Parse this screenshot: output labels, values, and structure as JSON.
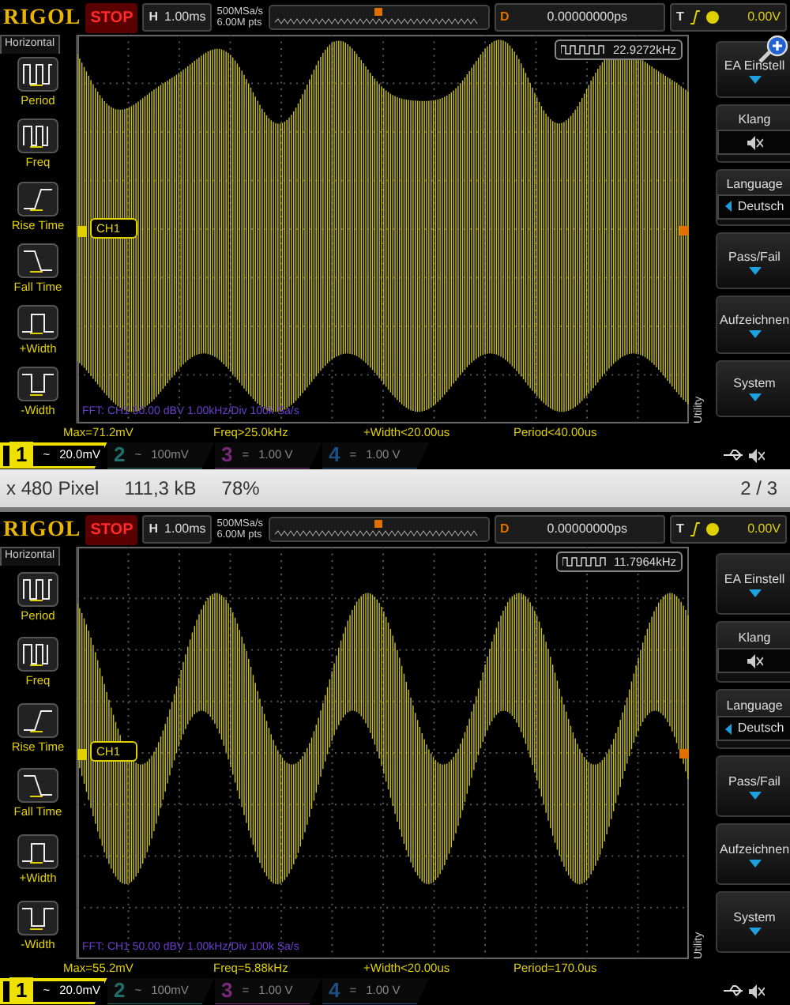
{
  "screens": [
    {
      "header": {
        "logo": "RIGOL",
        "run_state": "STOP",
        "timebase_label": "H",
        "timebase": "1.00ms",
        "sample_rate": "500MSa/s",
        "memory_depth": "6.00M pts",
        "delay_label": "D",
        "delay": "0.00000000ps",
        "trigger_label": "T",
        "trigger_level": "0.00V"
      },
      "left_menu": {
        "title": "Horizontal",
        "items": [
          {
            "label": "Period"
          },
          {
            "label": "Freq"
          },
          {
            "label": "Rise Time"
          },
          {
            "label": "Fall Time"
          },
          {
            "label": "+Width"
          },
          {
            "label": "-Width"
          }
        ]
      },
      "grid": {
        "counter": "22.9272kHz",
        "channel_marker": "CH1",
        "fft_info": "FFT: CH1 50.00 dBV 1.00kHz/Div 100k Sa/s"
      },
      "right_menu": {
        "title": "Utility",
        "items": [
          {
            "kind": "submenu",
            "label": "EA Einstell"
          },
          {
            "kind": "sound",
            "label": "Klang"
          },
          {
            "kind": "option",
            "label": "Language",
            "value": "Deutsch"
          },
          {
            "kind": "submenu",
            "label": "Pass/Fail"
          },
          {
            "kind": "submenu",
            "label": "Aufzeichnen"
          },
          {
            "kind": "submenu",
            "label": "System"
          }
        ]
      },
      "measurements": [
        "Max=71.2mV",
        "Freq>25.0kHz",
        "+Width<20.00us",
        "Period<40.00us"
      ],
      "channels": [
        {
          "number": "1",
          "coupling": "~",
          "scale": "20.0mV",
          "selected": true,
          "color": "#f0e000"
        },
        {
          "number": "2",
          "coupling": "~",
          "scale": "100mV",
          "selected": false,
          "color": "#1f6f6a"
        },
        {
          "number": "3",
          "coupling": "=",
          "scale": "1.00 V",
          "selected": false,
          "color": "#7a2a7a"
        },
        {
          "number": "4",
          "coupling": "=",
          "scale": "1.00 V",
          "selected": false,
          "color": "#1f4f80"
        }
      ]
    },
    {
      "header": {
        "logo": "RIGOL",
        "run_state": "STOP",
        "timebase_label": "H",
        "timebase": "1.00ms",
        "sample_rate": "500MSa/s",
        "memory_depth": "6.00M pts",
        "delay_label": "D",
        "delay": "0.00000000ps",
        "trigger_label": "T",
        "trigger_level": "0.00V"
      },
      "left_menu": {
        "title": "Horizontal",
        "items": [
          {
            "label": "Period"
          },
          {
            "label": "Freq"
          },
          {
            "label": "Rise Time"
          },
          {
            "label": "Fall Time"
          },
          {
            "label": "+Width"
          },
          {
            "label": "-Width"
          }
        ]
      },
      "grid": {
        "counter": "11.7964kHz",
        "channel_marker": "CH1",
        "fft_info": "FFT: CH1 50.00 dBV 1.00kHz/Div 100k Sa/s"
      },
      "right_menu": {
        "title": "Utility",
        "items": [
          {
            "kind": "submenu",
            "label": "EA Einstell"
          },
          {
            "kind": "sound",
            "label": "Klang"
          },
          {
            "kind": "option",
            "label": "Language",
            "value": "Deutsch"
          },
          {
            "kind": "submenu",
            "label": "Pass/Fail"
          },
          {
            "kind": "submenu",
            "label": "Aufzeichnen"
          },
          {
            "kind": "submenu",
            "label": "System"
          }
        ]
      },
      "measurements": [
        "Max=55.2mV",
        "Freq=5.88kHz",
        "+Width<20.00us",
        "Period=170.0us"
      ],
      "channels": [
        {
          "number": "1",
          "coupling": "~",
          "scale": "20.0mV",
          "selected": true,
          "color": "#f0e000"
        },
        {
          "number": "2",
          "coupling": "~",
          "scale": "100mV",
          "selected": false,
          "color": "#1f6f6a"
        },
        {
          "number": "3",
          "coupling": "=",
          "scale": "1.00 V",
          "selected": false,
          "color": "#7a2a7a"
        },
        {
          "number": "4",
          "coupling": "=",
          "scale": "1.00 V",
          "selected": false,
          "color": "#1f4f80"
        }
      ]
    }
  ],
  "viewer_bar": {
    "info": [
      "x 480 Pixel",
      "111,3 kB",
      "78%"
    ],
    "counter": "2 / 3"
  }
}
